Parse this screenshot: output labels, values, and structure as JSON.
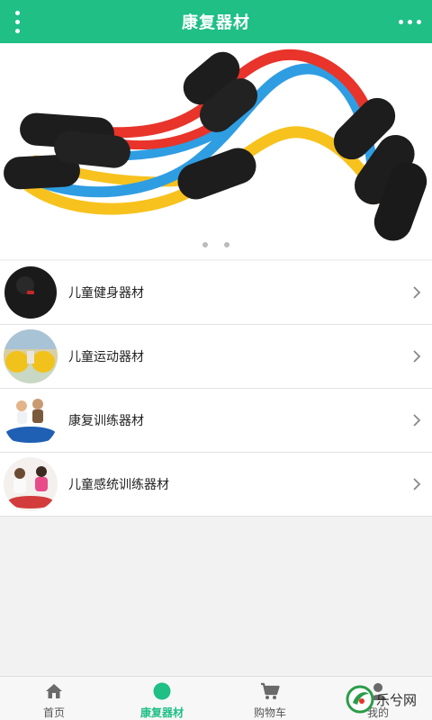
{
  "header": {
    "title": "康复器材"
  },
  "banner": {
    "slides": 2,
    "active_slide": 1
  },
  "categories": [
    {
      "label": "儿童健身器材"
    },
    {
      "label": "儿童运动器材"
    },
    {
      "label": "康复训练器材"
    },
    {
      "label": "儿童感统训练器材"
    }
  ],
  "nav": [
    {
      "label": "首页",
      "icon": "home-icon"
    },
    {
      "label": "康复器材",
      "icon": "circle-icon"
    },
    {
      "label": "购物车",
      "icon": "cart-icon"
    },
    {
      "label": "我的",
      "icon": "user-icon"
    }
  ],
  "watermark": {
    "text": "乐兮网"
  },
  "colors": {
    "brand": "#1fbf86",
    "banner_red": "#e8342a",
    "banner_blue": "#2f9de2",
    "banner_yellow": "#f7c21d"
  }
}
